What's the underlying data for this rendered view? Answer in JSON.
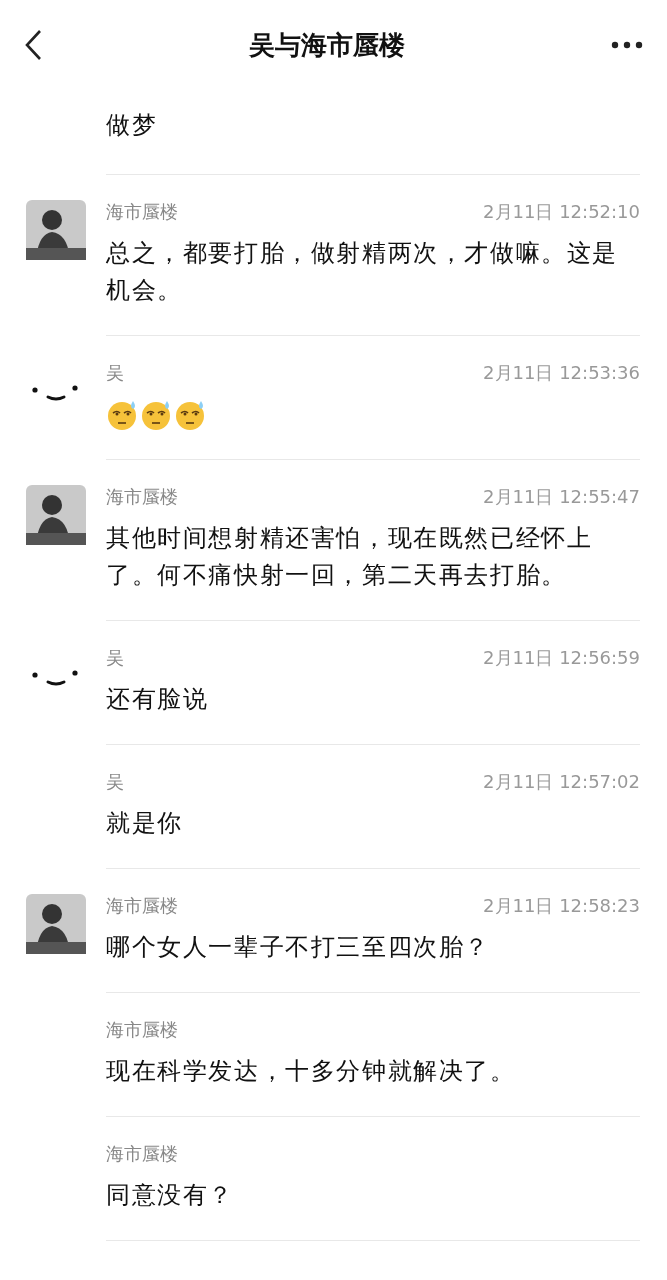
{
  "header": {
    "title": "吴与海市蜃楼"
  },
  "messages": [
    {
      "kind": "text",
      "text": "做梦"
    },
    {
      "kind": "text",
      "avatar": {
        "kind": "photo"
      },
      "name": "海市蜃楼",
      "time": "2月11日 12:52:10",
      "text": "总之，都要打胎，做射精两次，才做嘛。这是机会。"
    },
    {
      "kind": "emoji",
      "avatar": {
        "kind": "smiley"
      },
      "name": "吴",
      "time": "2月11日 12:53:36",
      "emoji": [
        {
          "kind": "sweat"
        },
        {
          "kind": "sweat"
        },
        {
          "kind": "sweat"
        }
      ]
    },
    {
      "kind": "text",
      "avatar": {
        "kind": "photo"
      },
      "name": "海市蜃楼",
      "time": "2月11日 12:55:47",
      "text": "其他时间想射精还害怕，现在既然已经怀上了。何不痛快射一回，第二天再去打胎。"
    },
    {
      "kind": "text",
      "avatar": {
        "kind": "smiley"
      },
      "name": "吴",
      "time": "2月11日 12:56:59",
      "text": "还有脸说"
    },
    {
      "kind": "text",
      "name": "吴",
      "time": "2月11日 12:57:02",
      "text": "就是你"
    },
    {
      "kind": "text",
      "avatar": {
        "kind": "photo"
      },
      "name": "海市蜃楼",
      "time": "2月11日 12:58:23",
      "text": "哪个女人一辈子不打三至四次胎？"
    },
    {
      "kind": "text",
      "name": "海市蜃楼",
      "text": "现在科学发达，十多分钟就解决了。"
    },
    {
      "kind": "text",
      "name": "海市蜃楼",
      "text": "同意没有？"
    }
  ]
}
